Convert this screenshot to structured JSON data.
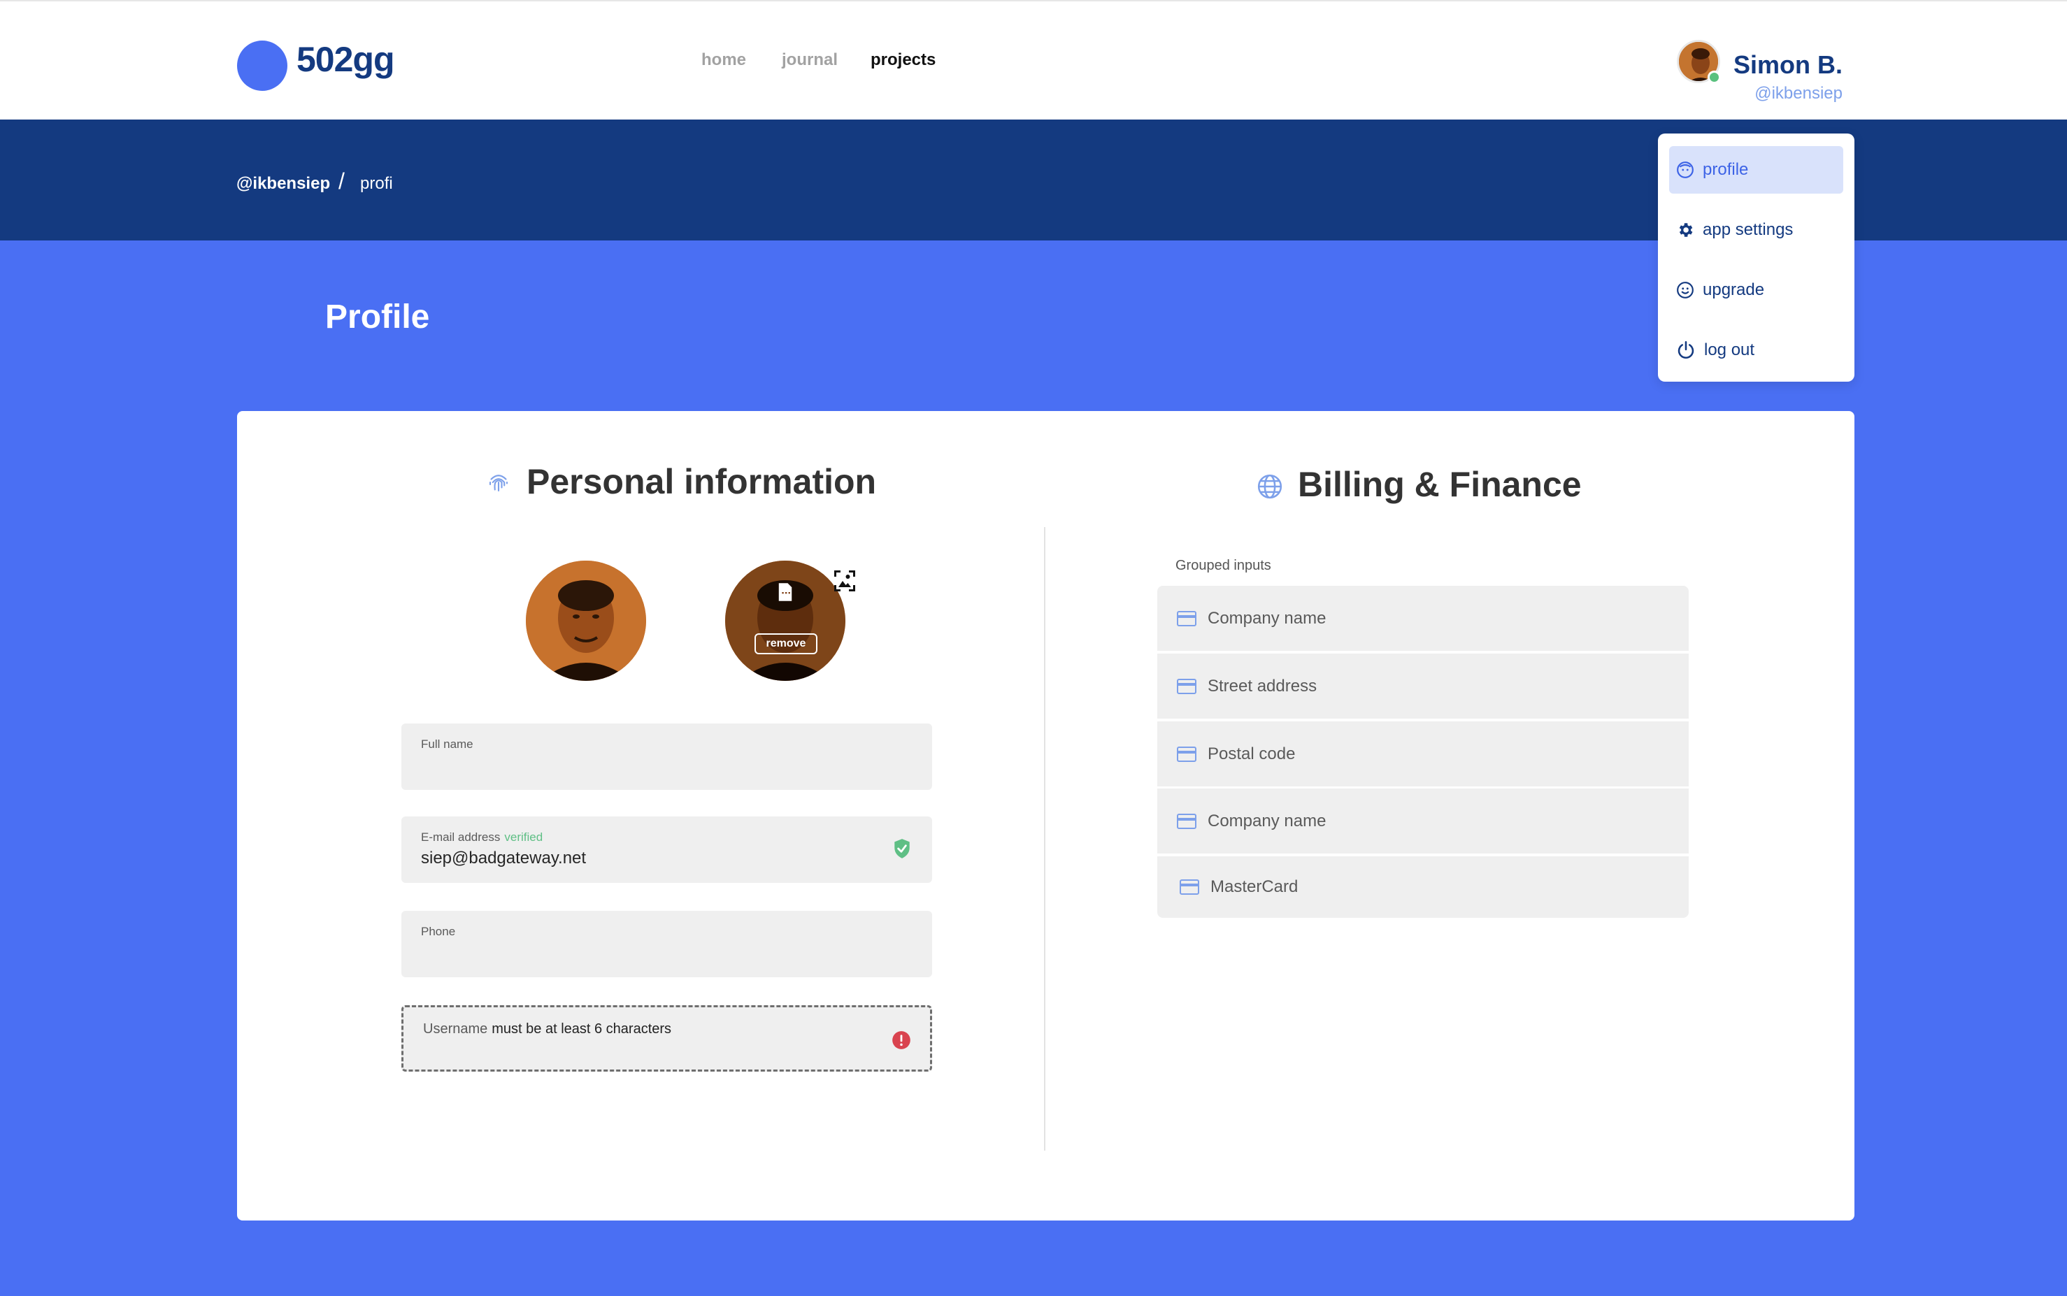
{
  "brand": {
    "name": "502gg",
    "color": "#4a6ff3"
  },
  "nav": {
    "items": [
      {
        "label": "home",
        "active": false
      },
      {
        "label": "journal",
        "active": false
      },
      {
        "label": "projects",
        "active": true
      }
    ]
  },
  "user": {
    "name": "Simon B.",
    "handle": "@ikbensiep",
    "status": "online"
  },
  "breadcrumb": {
    "user": "@ikbensiep",
    "separator": "/",
    "page": "profi"
  },
  "page": {
    "title": "Profile"
  },
  "dropdown": {
    "items": [
      {
        "label": "profile",
        "icon": "face-icon",
        "active": true
      },
      {
        "label": "app settings",
        "icon": "gear-icon",
        "active": false
      },
      {
        "label": "upgrade",
        "icon": "smiley-icon",
        "active": false
      },
      {
        "label": "log out",
        "icon": "power-icon",
        "active": false
      }
    ]
  },
  "personal": {
    "title": "Personal information",
    "icon": "fingerprint-icon",
    "avatar_remove_label": "remove",
    "fields": {
      "full_name": {
        "label": "Full name",
        "value": ""
      },
      "email": {
        "label": "E-mail address",
        "status": "verified",
        "value": "siep@badgateway.net"
      },
      "phone": {
        "label": "Phone",
        "value": ""
      },
      "username": {
        "label": "Username",
        "error": "must be at least 6 characters",
        "value": ""
      }
    }
  },
  "billing": {
    "title": "Billing & Finance",
    "icon": "globe-icon",
    "group_label": "Grouped inputs",
    "inputs": [
      {
        "placeholder": "Company name",
        "icon": "card-icon"
      },
      {
        "placeholder": "Street address",
        "icon": "card-icon"
      },
      {
        "placeholder": "Postal code",
        "icon": "card-icon"
      },
      {
        "placeholder": "Company name",
        "icon": "card-icon"
      },
      {
        "placeholder": "MasterCard",
        "icon": "card-icon"
      }
    ]
  },
  "colors": {
    "navy": "#143a80",
    "accent": "#4a6ff3",
    "verified": "#5fbf85",
    "error": "#d9434f"
  }
}
